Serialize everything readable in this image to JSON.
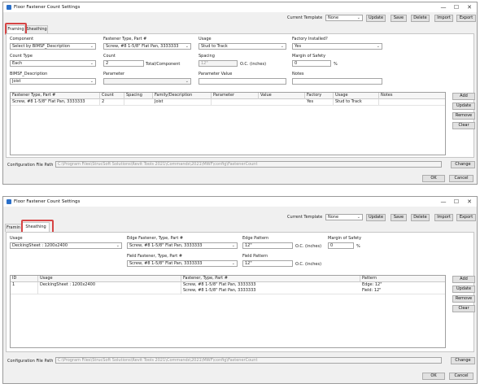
{
  "window_title": "Floor Fastener Count Settings",
  "window_controls": {
    "minimize": "—",
    "maximize": "☐",
    "close": "✕"
  },
  "toolbar": {
    "template_label": "Current Template",
    "template_value": "None",
    "update": "Update",
    "save": "Save",
    "delete": "Delete",
    "import": "Import",
    "export": "Export"
  },
  "tabs": {
    "framing": "Framing",
    "sheathing": "Sheathing",
    "framing_cut": "Framin"
  },
  "framing": {
    "component_label": "Component",
    "component_value": "Select by BIMSF_Description",
    "fastener_label": "Fastener Type, Part #",
    "fastener_value": "Screw, #8 1-5/8\" Flat Pan, 3333333",
    "usage_label": "Usage",
    "usage_value": "Stud to Track",
    "factory_label": "Factory Installed?",
    "factory_value": "Yes",
    "count_type_label": "Count Type",
    "count_type_value": "Each",
    "count_label": "Count",
    "count_value": "2",
    "count_suffix": "Total/Component",
    "spacing_label": "Spacing",
    "spacing_value": "12\"",
    "spacing_suffix": "O.C. (inches)",
    "margin_label": "Margin of Safety",
    "margin_value": "0",
    "margin_suffix": "%",
    "bimsf_label": "BIMSF_Description",
    "bimsf_value": "Joist",
    "parameter_label": "Parameter",
    "parameter_value_label": "Parameter Value",
    "notes_label": "Notes",
    "grid_headers": [
      "Fastener Type, Part #",
      "Count",
      "Spacing",
      "Family/Description",
      "Parameter",
      "Value",
      "Factory",
      "Usage",
      "Notes"
    ],
    "grid_rows": [
      [
        "Screw, #8 1-5/8\" Flat Pan, 3333333",
        "2",
        "",
        "Joist",
        "",
        "",
        "Yes",
        "Stud to Track",
        ""
      ]
    ],
    "side_buttons": {
      "add": "Add",
      "update": "Update",
      "remove": "Remove",
      "clear": "Clear"
    },
    "config_label": "Configuration File Path",
    "config_path": "C:\\Program Files\\StrucSoft Solutions\\Revit Tools 2021\\Commands\\2021\\MWF\\config\\FastenerCount",
    "change": "Change",
    "ok": "OK",
    "cancel": "Cancel"
  },
  "sheathing": {
    "usage_label": "Usage",
    "usage_value": "DeckingSheet : 1200x2400",
    "edge_fastener_label": "Edge Fastener, Type, Part #",
    "edge_fastener_value": "Screw, #8 1-5/8\" Flat Pan, 3333333",
    "edge_pattern_label": "Edge Pattern",
    "edge_pattern_value": "12\"",
    "edge_pattern_suffix": "O.C. (inches)",
    "margin_label": "Margin of Safety",
    "margin_value": "0",
    "margin_suffix": "%",
    "field_fastener_label": "Field Fastener, Type, Part #",
    "field_fastener_value": "Screw, #8 1-5/8\" Flat Pan, 3333333",
    "field_pattern_label": "Field Pattern",
    "field_pattern_value": "12\"",
    "field_pattern_suffix": "O.C. (inches)",
    "grid_headers": [
      "ID",
      "Usage",
      "Fastener, Type, Part #",
      "Pattern"
    ],
    "grid_row": {
      "id": "1",
      "usage": "DeckingSheet : 1200x2400",
      "fastener_1": "Screw, #8 1-5/8\" Flat Pan, 3333333",
      "fastener_2": "Screw, #8 1-5/8\" Flat Pan, 3333333",
      "pattern_1": "Edge: 12\"",
      "pattern_2": "Field: 12\""
    },
    "side_buttons": {
      "add": "Add",
      "update": "Update",
      "remove": "Remove",
      "clear": "Clear"
    },
    "config_label": "Configuration File Path",
    "config_path": "C:\\Program Files\\StrucSoft Solutions\\Revit Tools 2021\\Commands\\2021\\MWF\\config\\FastenerCount",
    "change": "Change",
    "ok": "OK",
    "cancel": "Cancel"
  },
  "colors": {
    "highlight": "#d64545",
    "app_icon": "#2a6fc9",
    "window_bg": "#f0f0f0"
  },
  "icons": {
    "dropdown": "chevron-down-icon",
    "app": "app-icon"
  }
}
